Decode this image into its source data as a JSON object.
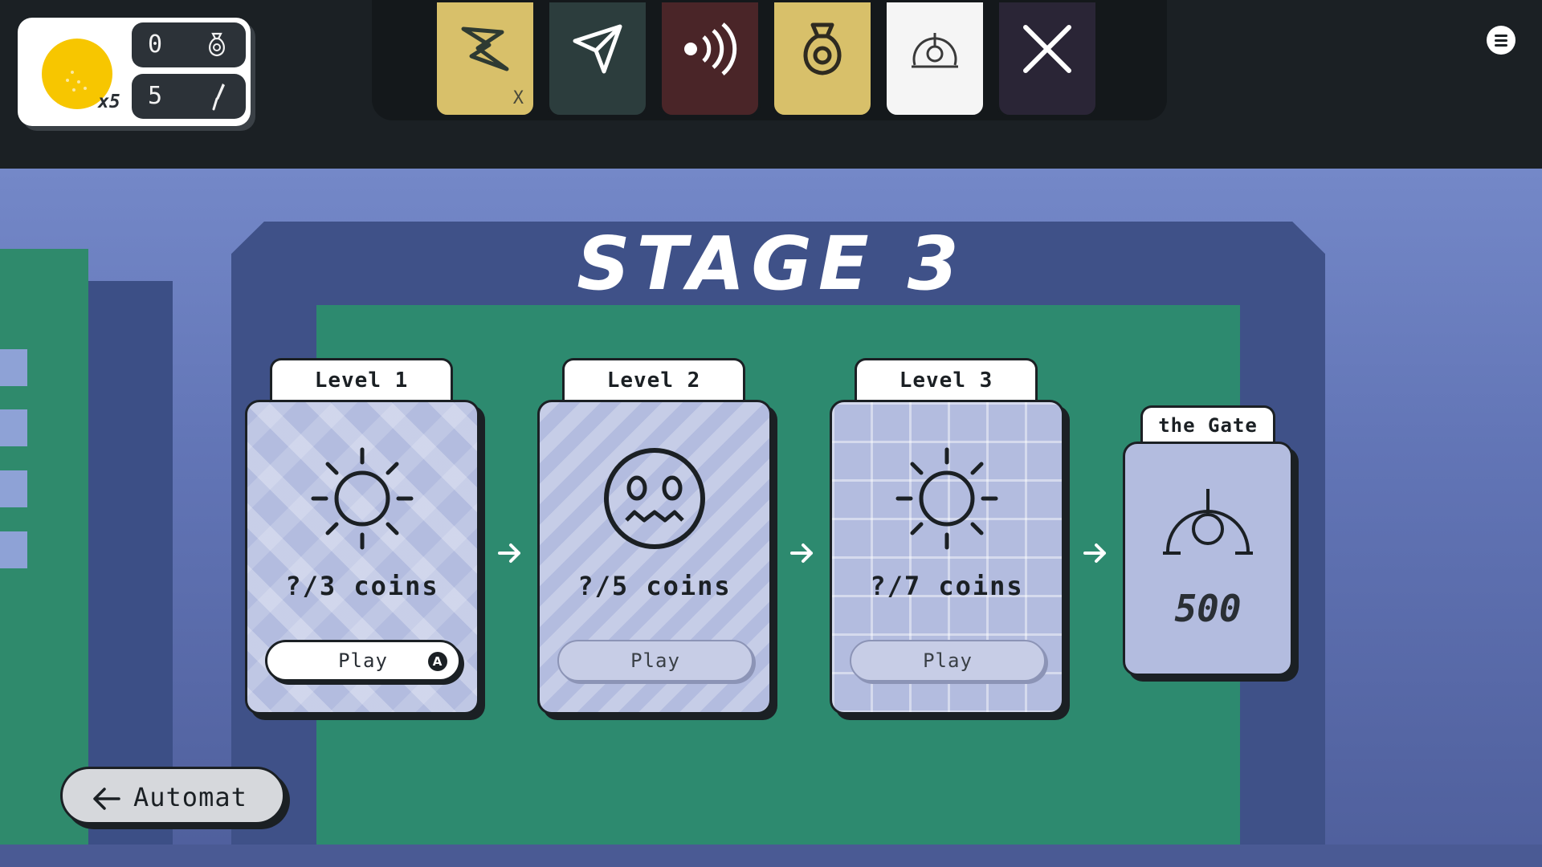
{
  "hud": {
    "coin_multiplier": "x5",
    "bags": "0",
    "picks": "5"
  },
  "powerups": [
    {
      "name": "lightning",
      "marker": "X"
    },
    {
      "name": "paper-plane",
      "marker": ""
    },
    {
      "name": "sound-waves",
      "marker": ""
    },
    {
      "name": "money-bag",
      "marker": ""
    },
    {
      "name": "gate",
      "marker": ""
    },
    {
      "name": "close",
      "marker": ""
    }
  ],
  "stage": {
    "title": "STAGE 3"
  },
  "levels": [
    {
      "tab": "Level 1",
      "coins": "?/3 coins",
      "play": "Play",
      "key": "A",
      "icon": "sun-icon"
    },
    {
      "tab": "Level 2",
      "coins": "?/5 coins",
      "play": "Play",
      "icon": "worried-face-icon"
    },
    {
      "tab": "Level 3",
      "coins": "?/7 coins",
      "play": "Play",
      "icon": "sun-icon"
    }
  ],
  "gate": {
    "tab": "the Gate",
    "cost": "500",
    "icon": "gate-icon"
  },
  "back": {
    "label": "Automat"
  },
  "colors": {
    "coin": "#f7c600",
    "card": "#b3bcdf",
    "board_green": "#2d8a6f",
    "sky": "#7488c8",
    "ink": "#1b2024"
  }
}
